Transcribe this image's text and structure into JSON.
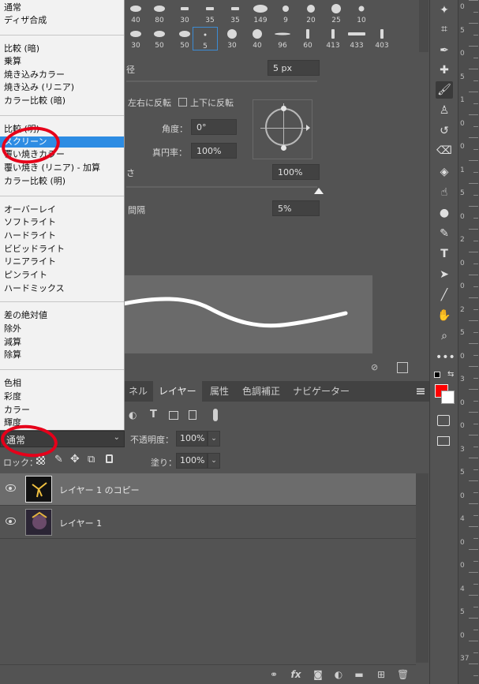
{
  "brushes": {
    "row1": [
      "40",
      "80",
      "30",
      "35",
      "35",
      "149",
      "9",
      "20",
      "25",
      "10"
    ],
    "row2": [
      "30",
      "50",
      "50",
      "5",
      "30",
      "40",
      "96",
      "60",
      "413",
      "433",
      "403"
    ]
  },
  "brush_settings": {
    "diameter_label": "径",
    "diameter_value": "5 px",
    "flip_x_label": "左右に反転",
    "flip_y_label": "上下に反転",
    "angle_label": "角度：",
    "angle_value": "0°",
    "roundness_label": "真円率：",
    "roundness_value": "100%",
    "hardness_label": "さ",
    "hardness_value": "100%",
    "spacing_label": "間隔",
    "spacing_value": "5%"
  },
  "blend_menu": {
    "groups": [
      [
        "通常",
        "ディザ合成"
      ],
      [
        "比較 (暗)",
        "乗算",
        "焼き込みカラー",
        "焼き込み (リニア)",
        "カラー比較 (暗)"
      ],
      [
        "比較 (明)",
        "スクリーン",
        "覆い焼きカラー",
        "覆い焼き (リニア) - 加算",
        "カラー比較 (明)"
      ],
      [
        "オーバーレイ",
        "ソフトライト",
        "ハードライト",
        "ビビッドライト",
        "リニアライト",
        "ピンライト",
        "ハードミックス"
      ],
      [
        "差の絶対値",
        "除外",
        "減算",
        "除算"
      ],
      [
        "色相",
        "彩度",
        "カラー",
        "輝度"
      ]
    ],
    "highlighted": "スクリーン"
  },
  "tabs": [
    "ネル",
    "レイヤー",
    "属性",
    "色調補正",
    "ナビゲーター"
  ],
  "active_tab": "レイヤー",
  "layer_panel": {
    "blend_mode": "通常",
    "opacity_label": "不透明度：",
    "opacity_value": "100%",
    "lock_label": "ロック：",
    "fill_label": "塗り：",
    "fill_value": "100%",
    "layers": [
      {
        "name": "レイヤー 1 のコピー",
        "selected": true
      },
      {
        "name": "レイヤー 1",
        "selected": false
      }
    ]
  },
  "colors": {
    "foreground": "#ff0000",
    "background": "#ffffff",
    "highlight": "#2d8ce3",
    "annotation": "#e6001a"
  },
  "ruler_labels": [
    "0",
    "5",
    "0",
    "5",
    "1",
    "0",
    "0",
    "1",
    "5",
    "0",
    "2",
    "0",
    "0",
    "2",
    "5",
    "0",
    "3",
    "0",
    "0",
    "3",
    "5",
    "0",
    "4",
    "0",
    "0",
    "4",
    "5",
    "0",
    "37"
  ]
}
